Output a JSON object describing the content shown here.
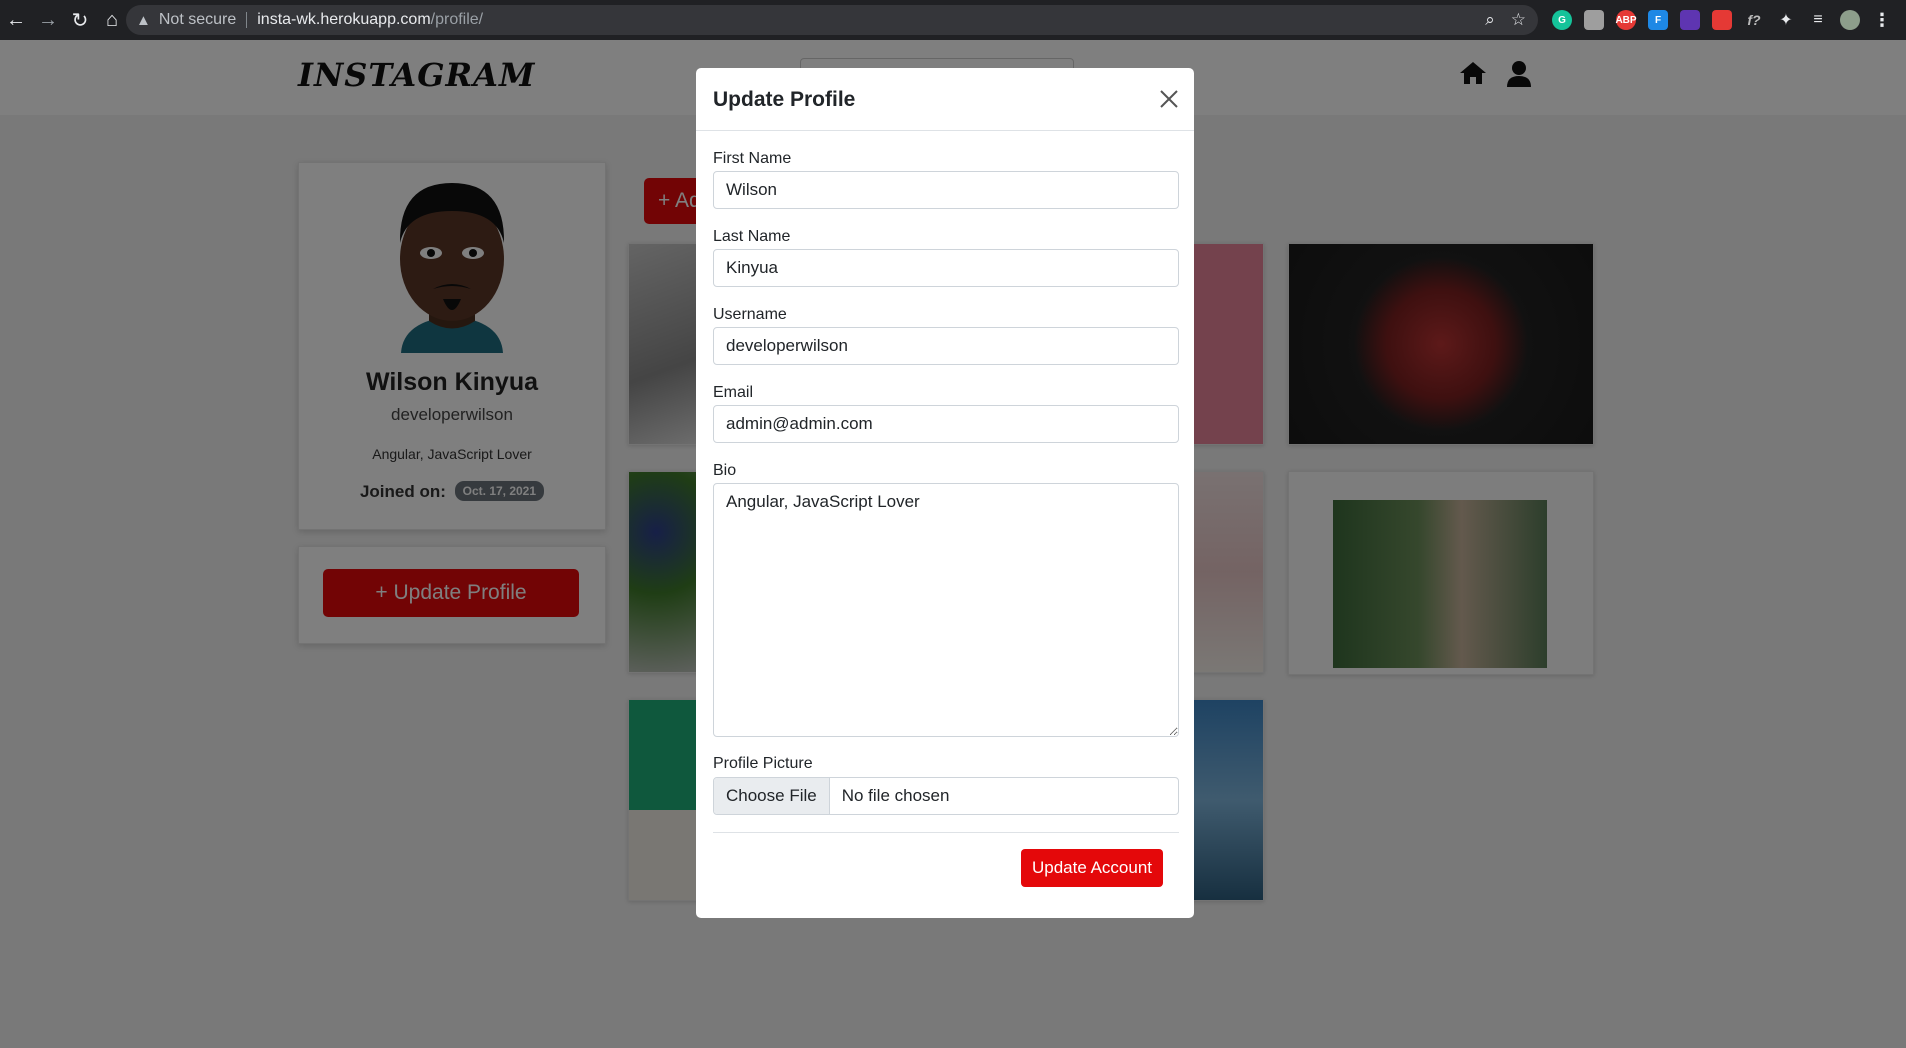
{
  "browser": {
    "security": "Not secure",
    "url_host": "insta-wk.herokuapp.com",
    "url_path": "/profile/"
  },
  "site": {
    "logo": "INSTAGRAM"
  },
  "profile": {
    "name": "Wilson Kinyua",
    "username": "developerwilson",
    "bio": "Angular, JavaScript Lover",
    "joined_label": "Joined on:",
    "joined_date": "Oct. 17, 2021",
    "update_button": "+ Update Profile",
    "add_button": "+ Ad"
  },
  "modal": {
    "title": "Update Profile",
    "fields": {
      "first_name_label": "First Name",
      "first_name": "Wilson",
      "last_name_label": "Last Name",
      "last_name": "Kinyua",
      "username_label": "Username",
      "username": "developerwilson",
      "email_label": "Email",
      "email": "admin@admin.com",
      "bio_label": "Bio",
      "bio": "Angular, JavaScript Lover",
      "picture_label": "Profile Picture",
      "choose_file": "Choose File",
      "no_file": "No file chosen"
    },
    "submit": "Update Account"
  },
  "colors": {
    "brand_red": "#e4080a",
    "badge_gray": "#6c757d"
  }
}
